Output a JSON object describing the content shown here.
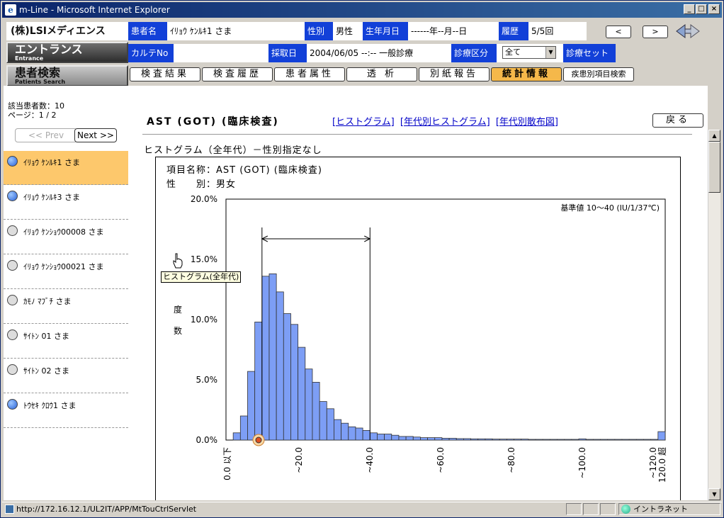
{
  "window": {
    "title": "m-Line - Microsoft Internet Explorer",
    "ie_icon": "e"
  },
  "header": {
    "logo": "(株)LSIメディエンス",
    "nav_entrance_jp": "エントランス",
    "nav_entrance_en": "Entrance",
    "nav_patients_jp": "患者検索",
    "nav_patients_en": "Patients Search",
    "patient_name_label": "患者名",
    "patient_name_value": "ｲﾘｮｳ ｹﾝﾙｷ1 さま",
    "sex_label": "性別",
    "sex_value": "男性",
    "dob_label": "生年月日",
    "dob_value": "------年--月--日",
    "history_label": "履歴",
    "history_value": "5/5回",
    "karte_label": "カルテNo",
    "karte_value": "",
    "collect_label": "採取日",
    "collect_value": "2004/06/05 --:-- 一般診療",
    "dept_label": "診療区分",
    "dept_value": "全て",
    "set_label": "診療セット",
    "prev_arrow": "<",
    "next_arrow": ">"
  },
  "tabs": [
    "検査結果",
    "検査履歴",
    "患者属性",
    "透 析",
    "別紙報告",
    "統計情報",
    "疾患別項目検索"
  ],
  "sidebar": {
    "count_text": "該当患者数：10",
    "page_text": "ページ：1 / 2",
    "prev_label": "<< Prev",
    "next_label": "Next >>",
    "patients": [
      {
        "name": "ｲﾘｮｳ ｹﾝﾙｷ1 さま",
        "icon": "blue"
      },
      {
        "name": "ｲﾘｮｳ ｹﾝﾙｷ3 さま",
        "icon": "blue"
      },
      {
        "name": "ｲﾘｮｳ ｹﾝｼｮｳ00008 さま",
        "icon": "gray"
      },
      {
        "name": "ｲﾘｮｳ ｹﾝｼｮｳ00021 さま",
        "icon": "gray"
      },
      {
        "name": "ｶﾓﾉ ﾏﾌﾞﾁ さま",
        "icon": "gray"
      },
      {
        "name": "ｻｲﾄﾝ 01 さま",
        "icon": "gray"
      },
      {
        "name": "ｻｲﾄﾝ 02 さま",
        "icon": "gray"
      },
      {
        "name": "ﾄｳｾｷ ｸﾛｳ1 さま",
        "icon": "blue"
      }
    ]
  },
  "main": {
    "title": "AST (GOT) (臨床検査)",
    "links": [
      "[ヒストグラム]",
      "[年代別ヒストグラム]",
      "[年代別散布図]"
    ],
    "back_label": "戻る",
    "subtitle": "ヒストグラム（全年代）－性別指定なし",
    "item_name": "項目名称：AST (GOT) (臨床検査)",
    "sex_line": "性　　別：男女",
    "tooltip": "ヒストグラム(全年代)"
  },
  "chart_data": {
    "type": "bar",
    "ylabel": "度数",
    "reference_note": "基準値 10～40 (IU/1/37℃)",
    "reference_range": [
      10,
      40
    ],
    "ylim": [
      0,
      20
    ],
    "yticks": [
      "20.0%",
      "15.0%",
      "10.0%",
      "5.0%",
      "0.0%"
    ],
    "xticks": [
      "0.0 以下",
      "~20.0",
      "~40.0",
      "~60.0",
      "~80.0",
      "~100.0",
      "~120.0",
      "120.0 超"
    ],
    "values": [
      0.0,
      0.6,
      2.0,
      5.7,
      9.8,
      13.6,
      13.8,
      12.3,
      10.5,
      9.6,
      7.7,
      5.9,
      4.8,
      3.2,
      2.6,
      1.7,
      1.4,
      1.1,
      1.0,
      0.8,
      0.6,
      0.5,
      0.5,
      0.4,
      0.3,
      0.3,
      0.25,
      0.2,
      0.2,
      0.2,
      0.15,
      0.15,
      0.12,
      0.12,
      0.1,
      0.1,
      0.1,
      0.08,
      0.08,
      0.08,
      0.08,
      0.08,
      0.06,
      0.06,
      0.06,
      0.06,
      0.06,
      0.06,
      0.06,
      0.1,
      0.06,
      0.06,
      0.06,
      0.06,
      0.06,
      0.06,
      0.06,
      0.06,
      0.06,
      0.06,
      0.7
    ],
    "bar_color": "#7d9ef5",
    "marker_value": 0
  },
  "statusbar": {
    "url": "http://172.16.12.1/UL2IT/APP/MtTouCtrlServlet",
    "zone": "イントラネット"
  },
  "colors": {
    "label_blue": "#1240d8",
    "active_tab": "#f5b84a",
    "selected_patient": "#fdc86c"
  }
}
